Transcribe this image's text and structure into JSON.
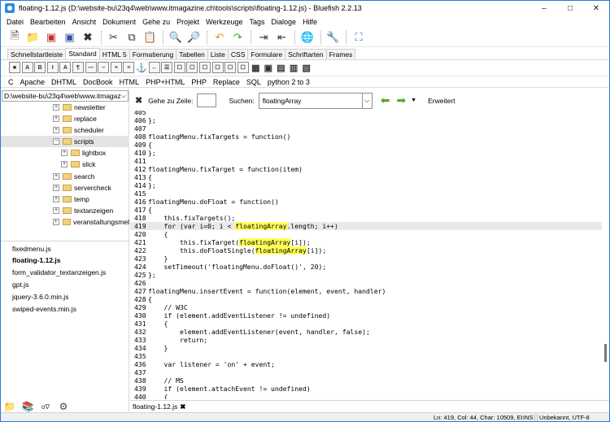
{
  "window": {
    "title": "floating-1.12.js (D:\\website-bu\\23q4\\web\\www.itmagazine.ch\\tools\\scripts\\floating-1.12.js) - Bluefish 2.2.13",
    "minimize": "–",
    "maximize": "□",
    "close": "✕"
  },
  "menu": [
    "Datei",
    "Bearbeiten",
    "Ansicht",
    "Dokument",
    "Gehe zu",
    "Projekt",
    "Werkzeuge",
    "Tags",
    "Dialoge",
    "Hilfe"
  ],
  "toolbar_icons": [
    "new-file-icon",
    "open-folder-icon",
    "save-icon",
    "save-as-icon",
    "close-icon",
    "cut-icon",
    "copy-icon",
    "paste-icon",
    "find-icon",
    "find-replace-icon",
    "undo-icon",
    "redo-icon",
    "indent-icon",
    "unindent-icon",
    "preview-icon",
    "settings-icon",
    "fullscreen-icon"
  ],
  "tabs": [
    "Schnellstartleiste",
    "Standard",
    "HTML 5",
    "Formatierung",
    "Tabellen",
    "Liste",
    "CSS",
    "Formulare",
    "Schriftarten",
    "Frames"
  ],
  "active_tab": "Standard",
  "html_buttons": [
    "■",
    "A",
    "B",
    "I",
    "A",
    "¶",
    "—",
    "–",
    "≡",
    "≡",
    "⚓",
    "↔",
    "☰",
    "☐",
    "☐",
    "☐",
    "☐",
    "☐",
    "☐",
    "▦",
    "▣",
    "▤",
    "▥",
    "▧"
  ],
  "custom_menu": [
    "C",
    "Apache",
    "DHTML",
    "DocBook",
    "HTML",
    "PHP+HTML",
    "PHP",
    "Replace",
    "SQL",
    "python 2 to 3"
  ],
  "sidebar": {
    "path": "D:\\website-bu\\23q4\\web\\www.itmagaz",
    "tree": [
      {
        "label": "newsletter",
        "indent": 0,
        "selected": false
      },
      {
        "label": "replace",
        "indent": 0,
        "selected": false
      },
      {
        "label": "scheduler",
        "indent": 0,
        "selected": false
      },
      {
        "label": "scripts",
        "indent": 0,
        "selected": true,
        "expanded": true
      },
      {
        "label": "lightbox",
        "indent": 1,
        "selected": false
      },
      {
        "label": "slick",
        "indent": 1,
        "selected": false
      },
      {
        "label": "search",
        "indent": 0,
        "selected": false
      },
      {
        "label": "servercheck",
        "indent": 0,
        "selected": false
      },
      {
        "label": "temp",
        "indent": 0,
        "selected": false
      },
      {
        "label": "textanzeigen",
        "indent": 0,
        "selected": false
      },
      {
        "label": "veranstaltungsmel",
        "indent": 0,
        "selected": false
      }
    ],
    "files": [
      {
        "label": "fixedmenu.js",
        "active": false
      },
      {
        "label": "floating-1.12.js",
        "active": true
      },
      {
        "label": "form_validator_textanzeigen.js",
        "active": false
      },
      {
        "label": "gpt.js",
        "active": false
      },
      {
        "label": "jquery-3.6.0.min.js",
        "active": false
      },
      {
        "label": "swiped-events.min.js",
        "active": false
      }
    ]
  },
  "search": {
    "goto_label": "Gehe zu Zeile:",
    "goto_value": "",
    "search_label": "Suchen:",
    "search_value": "floatingArray",
    "advanced_label": "Erweitert"
  },
  "editor": {
    "current_line": "419",
    "highlight": "floatingArray",
    "lines": [
      {
        "n": "405",
        "t": ""
      },
      {
        "n": "406",
        "t": "};"
      },
      {
        "n": "407",
        "t": ""
      },
      {
        "n": "408",
        "t": "floatingMenu.fixTargets = function()"
      },
      {
        "n": "409",
        "t": "{"
      },
      {
        "n": "410",
        "t": "};"
      },
      {
        "n": "411",
        "t": ""
      },
      {
        "n": "412",
        "t": "floatingMenu.fixTarget = function(item)"
      },
      {
        "n": "413",
        "t": "{"
      },
      {
        "n": "414",
        "t": "};"
      },
      {
        "n": "415",
        "t": ""
      },
      {
        "n": "416",
        "t": "floatingMenu.doFloat = function()"
      },
      {
        "n": "417",
        "t": "{"
      },
      {
        "n": "418",
        "t": "    this.fixTargets();"
      },
      {
        "n": "419",
        "t": "    for (var i=0; i < floatingArray.length; i++)"
      },
      {
        "n": "420",
        "t": "    {"
      },
      {
        "n": "421",
        "t": "        this.fixTarget(floatingArray[i]);"
      },
      {
        "n": "422",
        "t": "        this.doFloatSingle(floatingArray[i]);"
      },
      {
        "n": "423",
        "t": "    }"
      },
      {
        "n": "424",
        "t": "    setTimeout('floatingMenu.doFloat()', 20);"
      },
      {
        "n": "425",
        "t": "};"
      },
      {
        "n": "426",
        "t": ""
      },
      {
        "n": "427",
        "t": "floatingMenu.insertEvent = function(element, event, handler)"
      },
      {
        "n": "428",
        "t": "{"
      },
      {
        "n": "429",
        "t": "    // W3C"
      },
      {
        "n": "430",
        "t": "    if (element.addEventListener != undefined)"
      },
      {
        "n": "431",
        "t": "    {"
      },
      {
        "n": "432",
        "t": "        element.addEventListener(event, handler, false);"
      },
      {
        "n": "433",
        "t": "        return;"
      },
      {
        "n": "434",
        "t": "    }"
      },
      {
        "n": "435",
        "t": ""
      },
      {
        "n": "436",
        "t": "    var listener = 'on' + event;"
      },
      {
        "n": "437",
        "t": ""
      },
      {
        "n": "438",
        "t": "    // MS"
      },
      {
        "n": "439",
        "t": "    if (element.attachEvent != undefined)"
      },
      {
        "n": "440",
        "t": "    {"
      }
    ]
  },
  "doc_tab": {
    "label": "floating-1.12.js",
    "close": "✖"
  },
  "status": {
    "position": "Ln: 419, Col: 44, Char: 10509, EI",
    "mode": "INS",
    "encoding": "Unbekannt, UTF-8"
  },
  "colors": {
    "accent": "#2a7ad5",
    "highlight": "#ffff5a",
    "current_line": "#e9e9e9"
  }
}
